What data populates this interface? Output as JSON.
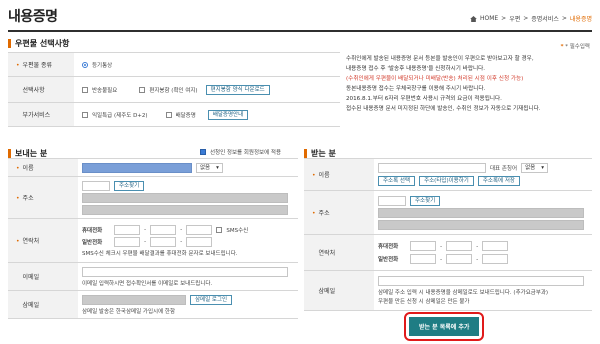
{
  "page": {
    "title": "내용증명",
    "breadcrumb": [
      "HOME",
      "우편",
      "증명서비스",
      "내용증명"
    ],
    "required_note": "* 필수입력"
  },
  "mail_type": {
    "section_title": "우편물 선택사항",
    "rows": {
      "kind_label": "우편물 종류",
      "kind_value": "등기통상",
      "options_label": "선택사항",
      "opt1": "반송불필요",
      "opt2": "편지봉함 (확인 여지)",
      "opt2_button": "편지봉함 양식 다운로드",
      "extra_label": "부가서비스",
      "extra1": "익일특급 (제주도 D+2)",
      "extra2": "배달증명",
      "extra_button": "배달증명안내"
    },
    "notices": [
      "수취인에게 발송된 내용증명 문서 등본을 발송인이 우편으로 받아보고자 할 경우,",
      "내용증명 접수 후 '발송후 내용증명'을 신청하시기 바랍니다.",
      "(수취인에게 우편물이 배달되거나 미배달(반송) 처리된 시점 이후 신청 가능)",
      "동본내용증명 접수는 우체국창구를 이용해 주시기 바랍니다.",
      "2016.8.1.부터 6자리 우편번호 사용시 규격외 요금이 적용됩니다.",
      "접수된 내용증명 문서 미지정된 하단에 발송인, 수취인 정보가 자동으로 기재됩니다."
    ]
  },
  "sender": {
    "section_title": "보내는 분",
    "save_info": "선청인 정보를 회원정보에 적용",
    "name_label": "이름",
    "name_suffix": "없음",
    "address_label": "주소",
    "address_button": "주소찾기",
    "contact_label": "연락처",
    "mobile_label": "휴대전화",
    "phone_label": "일반전화",
    "sms_label": "SMS수신",
    "sms_note": "SMS수신 체크시 우편물 배달결과를 휴대전화 문자로 보내드립니다.",
    "email_label": "이메일",
    "email_note": "이메일 입력하시면 접수확인서를 이메일로 보내드립니다.",
    "smail_label": "삼메일",
    "smail_button": "삼메일 로그인",
    "smail_note": "삼메일 발송은 한국삼메일 가입시에 한함"
  },
  "receiver": {
    "section_title": "받는 분",
    "name_label": "이름",
    "honorific_label": "대표 존칭어",
    "honorific_value": "없음",
    "addr_btn1": "주소록 선택",
    "addr_btn2": "주소(타입)이용하기",
    "addr_btn3": "주소록에 저장",
    "address_label": "주소",
    "address_button": "주소찾기",
    "contact_label": "연락처",
    "mobile_label": "휴대전화",
    "phone_label": "일반전화",
    "smail_label": "삼메일",
    "smail_note1": "삼메일 주소 입력 시 내용증명을 삼메일로도 보내드립니다. (추가요금부과)",
    "smail_note2": "우편물 만든 신청 시 삼메일은 만든 불가"
  },
  "submit": {
    "label": "받는 분 목록에 추가"
  },
  "colors": {
    "accent": "#e06a00",
    "button_teal": "#1f7d84",
    "highlight_red": "#e01a1a"
  }
}
